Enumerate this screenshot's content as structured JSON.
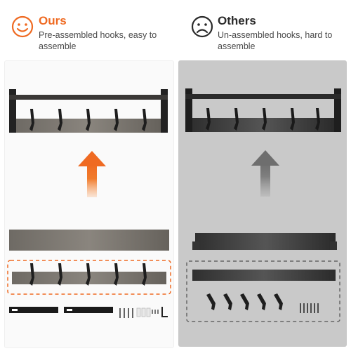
{
  "ours": {
    "title": "Ours",
    "description": "Pre-assembled hooks, easy to assemble",
    "face_icon": "smiley-face-icon",
    "accent_color": "#ef6a22"
  },
  "others": {
    "title": "Others",
    "description": "Un-assembled hooks, hard to assemble",
    "face_icon": "sad-face-icon",
    "accent_color": "#7a7a7a"
  }
}
